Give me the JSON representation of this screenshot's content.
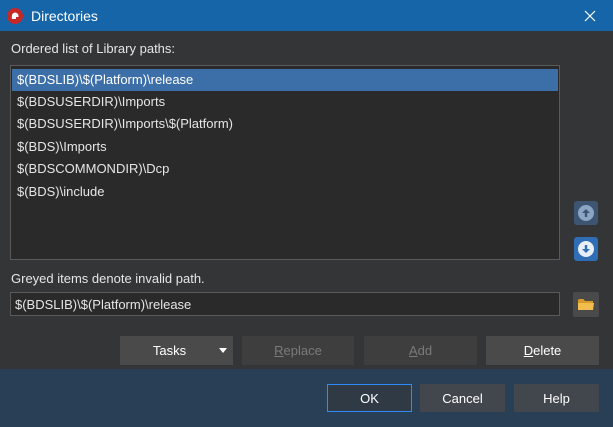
{
  "window": {
    "title": "Directories",
    "icon": "delphi-helmet-icon"
  },
  "list": {
    "label": "Ordered list of Library paths:",
    "items": [
      {
        "text": "$(BDSLIB)\\$(Platform)\\release",
        "selected": true
      },
      {
        "text": "$(BDSUSERDIR)\\Imports",
        "selected": false
      },
      {
        "text": "$(BDSUSERDIR)\\Imports\\$(Platform)",
        "selected": false
      },
      {
        "text": "$(BDS)\\Imports",
        "selected": false
      },
      {
        "text": "$(BDSCOMMONDIR)\\Dcp",
        "selected": false
      },
      {
        "text": "$(BDS)\\include",
        "selected": false
      }
    ]
  },
  "hint": "Greyed items denote invalid path.",
  "path_input": {
    "value": "$(BDSLIB)\\$(Platform)\\release"
  },
  "actions": {
    "tasks": "Tasks",
    "replace": "Replace",
    "add": "Add",
    "delete": "Delete"
  },
  "footer": {
    "ok": "OK",
    "cancel": "Cancel",
    "help": "Help"
  },
  "colors": {
    "titlebar": "#1565a8",
    "selection": "#3c6fa8",
    "footer": "#293f55",
    "focus_border": "#2e8bff"
  }
}
